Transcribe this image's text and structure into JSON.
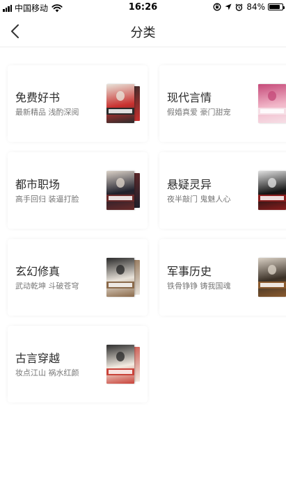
{
  "status_bar": {
    "carrier": "中国移动",
    "time": "16:26",
    "battery": "84%"
  },
  "nav": {
    "title": "分类",
    "back_icon": "chevron-left-icon"
  },
  "categories": [
    {
      "title": "免费好书",
      "subtitle": "最新精品 浅酌深阅",
      "cover_colors": [
        "#c9312f",
        "#2b2b2b",
        "#e8e2d8"
      ]
    },
    {
      "title": "现代言情",
      "subtitle": "假婚真爱 豪门甜宠",
      "cover_colors": [
        "#f1b6c8",
        "#f6dfe6",
        "#c64b7a"
      ]
    },
    {
      "title": "都市职场",
      "subtitle": "高手回归 装逼打脸",
      "cover_colors": [
        "#1f1f2b",
        "#6a2a2a",
        "#d9d0c6"
      ]
    },
    {
      "title": "悬疑灵异",
      "subtitle": "夜半敲门 鬼魅人心",
      "cover_colors": [
        "#141414",
        "#8a1d1d",
        "#dedede"
      ]
    },
    {
      "title": "玄幻修真",
      "subtitle": "武动乾坤 斗破苍穹",
      "cover_colors": [
        "#e9e3da",
        "#8b6a4a",
        "#2a2a2a"
      ]
    },
    {
      "title": "军事历史",
      "subtitle": "铁骨铮铮 铸我国魂",
      "cover_colors": [
        "#3a3026",
        "#8a5a2e",
        "#d8cfc3"
      ]
    },
    {
      "title": "古言穿越",
      "subtitle": "妆点江山 祸水红颜",
      "cover_colors": [
        "#f3ece2",
        "#c9433a",
        "#2e2e2e"
      ]
    }
  ]
}
